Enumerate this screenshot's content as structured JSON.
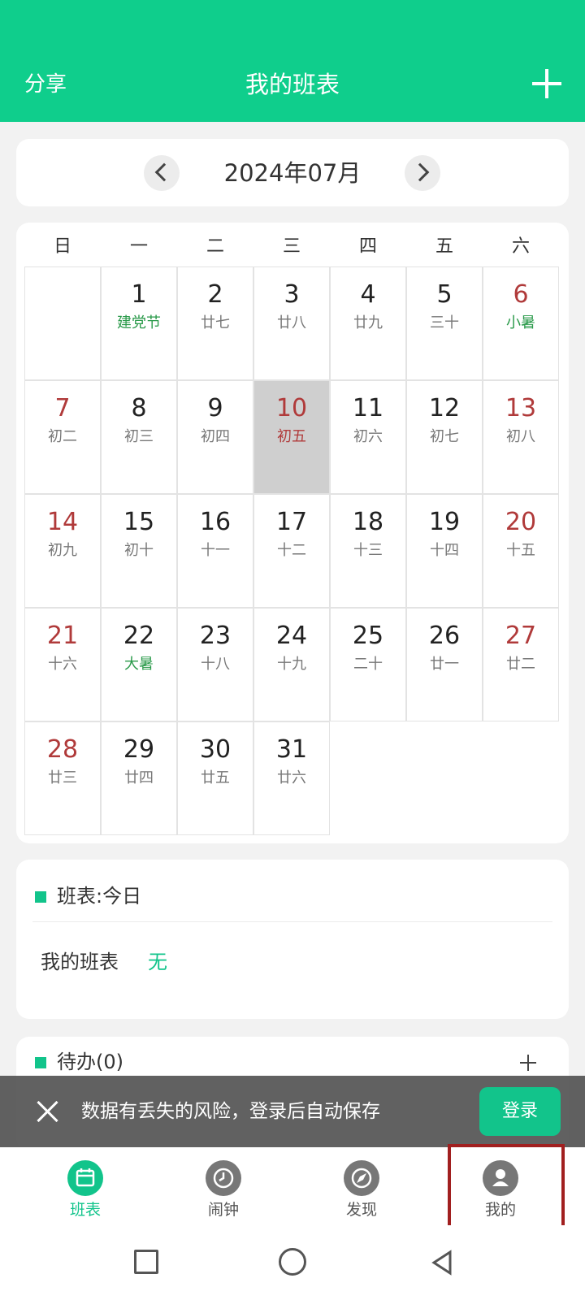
{
  "header": {
    "share_label": "分享",
    "title": "我的班表",
    "add_icon": "plus-icon",
    "color": "#0fce8c"
  },
  "month_nav": {
    "label": "2024年07月",
    "prev_icon": "chevron-left-icon",
    "next_icon": "chevron-right-icon"
  },
  "weekdays": [
    "日",
    "一",
    "二",
    "三",
    "四",
    "五",
    "六"
  ],
  "calendar": {
    "today": 10,
    "days": [
      {
        "day": "1",
        "lunar": "建党节",
        "festival": true
      },
      {
        "day": "2",
        "lunar": "廿七"
      },
      {
        "day": "3",
        "lunar": "廿八"
      },
      {
        "day": "4",
        "lunar": "廿九"
      },
      {
        "day": "5",
        "lunar": "三十"
      },
      {
        "day": "6",
        "lunar": "小暑",
        "festival": true
      },
      {
        "day": "7",
        "lunar": "初二"
      },
      {
        "day": "8",
        "lunar": "初三"
      },
      {
        "day": "9",
        "lunar": "初四"
      },
      {
        "day": "10",
        "lunar": "初五"
      },
      {
        "day": "11",
        "lunar": "初六"
      },
      {
        "day": "12",
        "lunar": "初七"
      },
      {
        "day": "13",
        "lunar": "初八"
      },
      {
        "day": "14",
        "lunar": "初九"
      },
      {
        "day": "15",
        "lunar": "初十"
      },
      {
        "day": "16",
        "lunar": "十一"
      },
      {
        "day": "17",
        "lunar": "十二"
      },
      {
        "day": "18",
        "lunar": "十三"
      },
      {
        "day": "19",
        "lunar": "十四"
      },
      {
        "day": "20",
        "lunar": "十五"
      },
      {
        "day": "21",
        "lunar": "十六"
      },
      {
        "day": "22",
        "lunar": "大暑",
        "festival": true
      },
      {
        "day": "23",
        "lunar": "十八"
      },
      {
        "day": "24",
        "lunar": "十九"
      },
      {
        "day": "25",
        "lunar": "二十"
      },
      {
        "day": "26",
        "lunar": "廿一"
      },
      {
        "day": "27",
        "lunar": "廿二"
      },
      {
        "day": "28",
        "lunar": "廿三"
      },
      {
        "day": "29",
        "lunar": "廿四"
      },
      {
        "day": "30",
        "lunar": "廿五"
      },
      {
        "day": "31",
        "lunar": "廿六"
      }
    ]
  },
  "today_section": {
    "title": "班表:今日",
    "row_label": "我的班表",
    "row_value": "无"
  },
  "todo_section": {
    "title": "待办(0)",
    "add_icon": "plus-icon"
  },
  "banner": {
    "message": "数据有丢失的风险，登录后自动保存",
    "login_label": "登录",
    "close_icon": "close-icon"
  },
  "tabbar": {
    "items": [
      {
        "label": "班表",
        "icon": "calendar-icon",
        "active": true
      },
      {
        "label": "闹钟",
        "icon": "clock-icon"
      },
      {
        "label": "发现",
        "icon": "compass-icon"
      },
      {
        "label": "我的",
        "icon": "user-icon"
      }
    ]
  },
  "colors": {
    "accent": "#12c48b",
    "weekend": "#b03a3a",
    "festival": "#2a9a4a",
    "highlight": "#a11f1f"
  }
}
